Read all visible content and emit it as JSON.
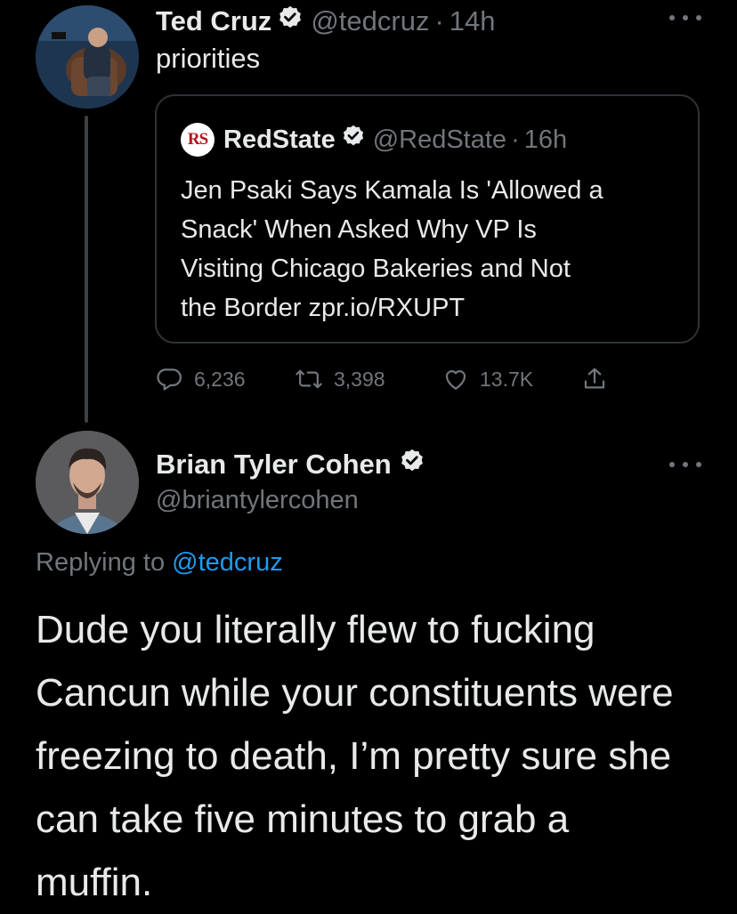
{
  "tweet": {
    "author_name": "Ted Cruz",
    "author_handle": "@tedcruz",
    "separator": "·",
    "time": "14h",
    "text": "priorities",
    "avatar_icon": "avatar-photo-icon",
    "verified_icon": "verified-badge-icon",
    "more_icon": "more-options-icon"
  },
  "quote": {
    "logo_text": "RS",
    "author_name": "RedState",
    "author_handle": "@RedState",
    "separator": "·",
    "time": "16h",
    "text_lines": [
      "Jen Psaki Says Kamala Is 'Allowed a",
      "Snack' When Asked Why VP Is",
      "Visiting Chicago Bakeries and Not",
      "the Border zpr.io/RXUPT"
    ]
  },
  "actions": {
    "replies": "6,236",
    "retweets": "3,398",
    "likes": "13.7K",
    "icons": [
      "reply-icon",
      "retweet-icon",
      "like-icon",
      "share-icon"
    ]
  },
  "reply": {
    "author_name": "Brian Tyler Cohen",
    "author_handle": "@briantylercohen",
    "replying_prefix": "Replying to",
    "replying_handle": "@tedcruz",
    "text_lines": [
      "Dude you literally flew to fucking",
      "Cancun while your constituents were",
      "freezing to death, I’m pretty sure she",
      "can take five minutes to grab a",
      "muffin."
    ]
  },
  "colors": {
    "background": "#000000",
    "text": "#e7e9ea",
    "muted": "#71767b",
    "accent": "#1d9bf0",
    "border": "#2f3336"
  }
}
